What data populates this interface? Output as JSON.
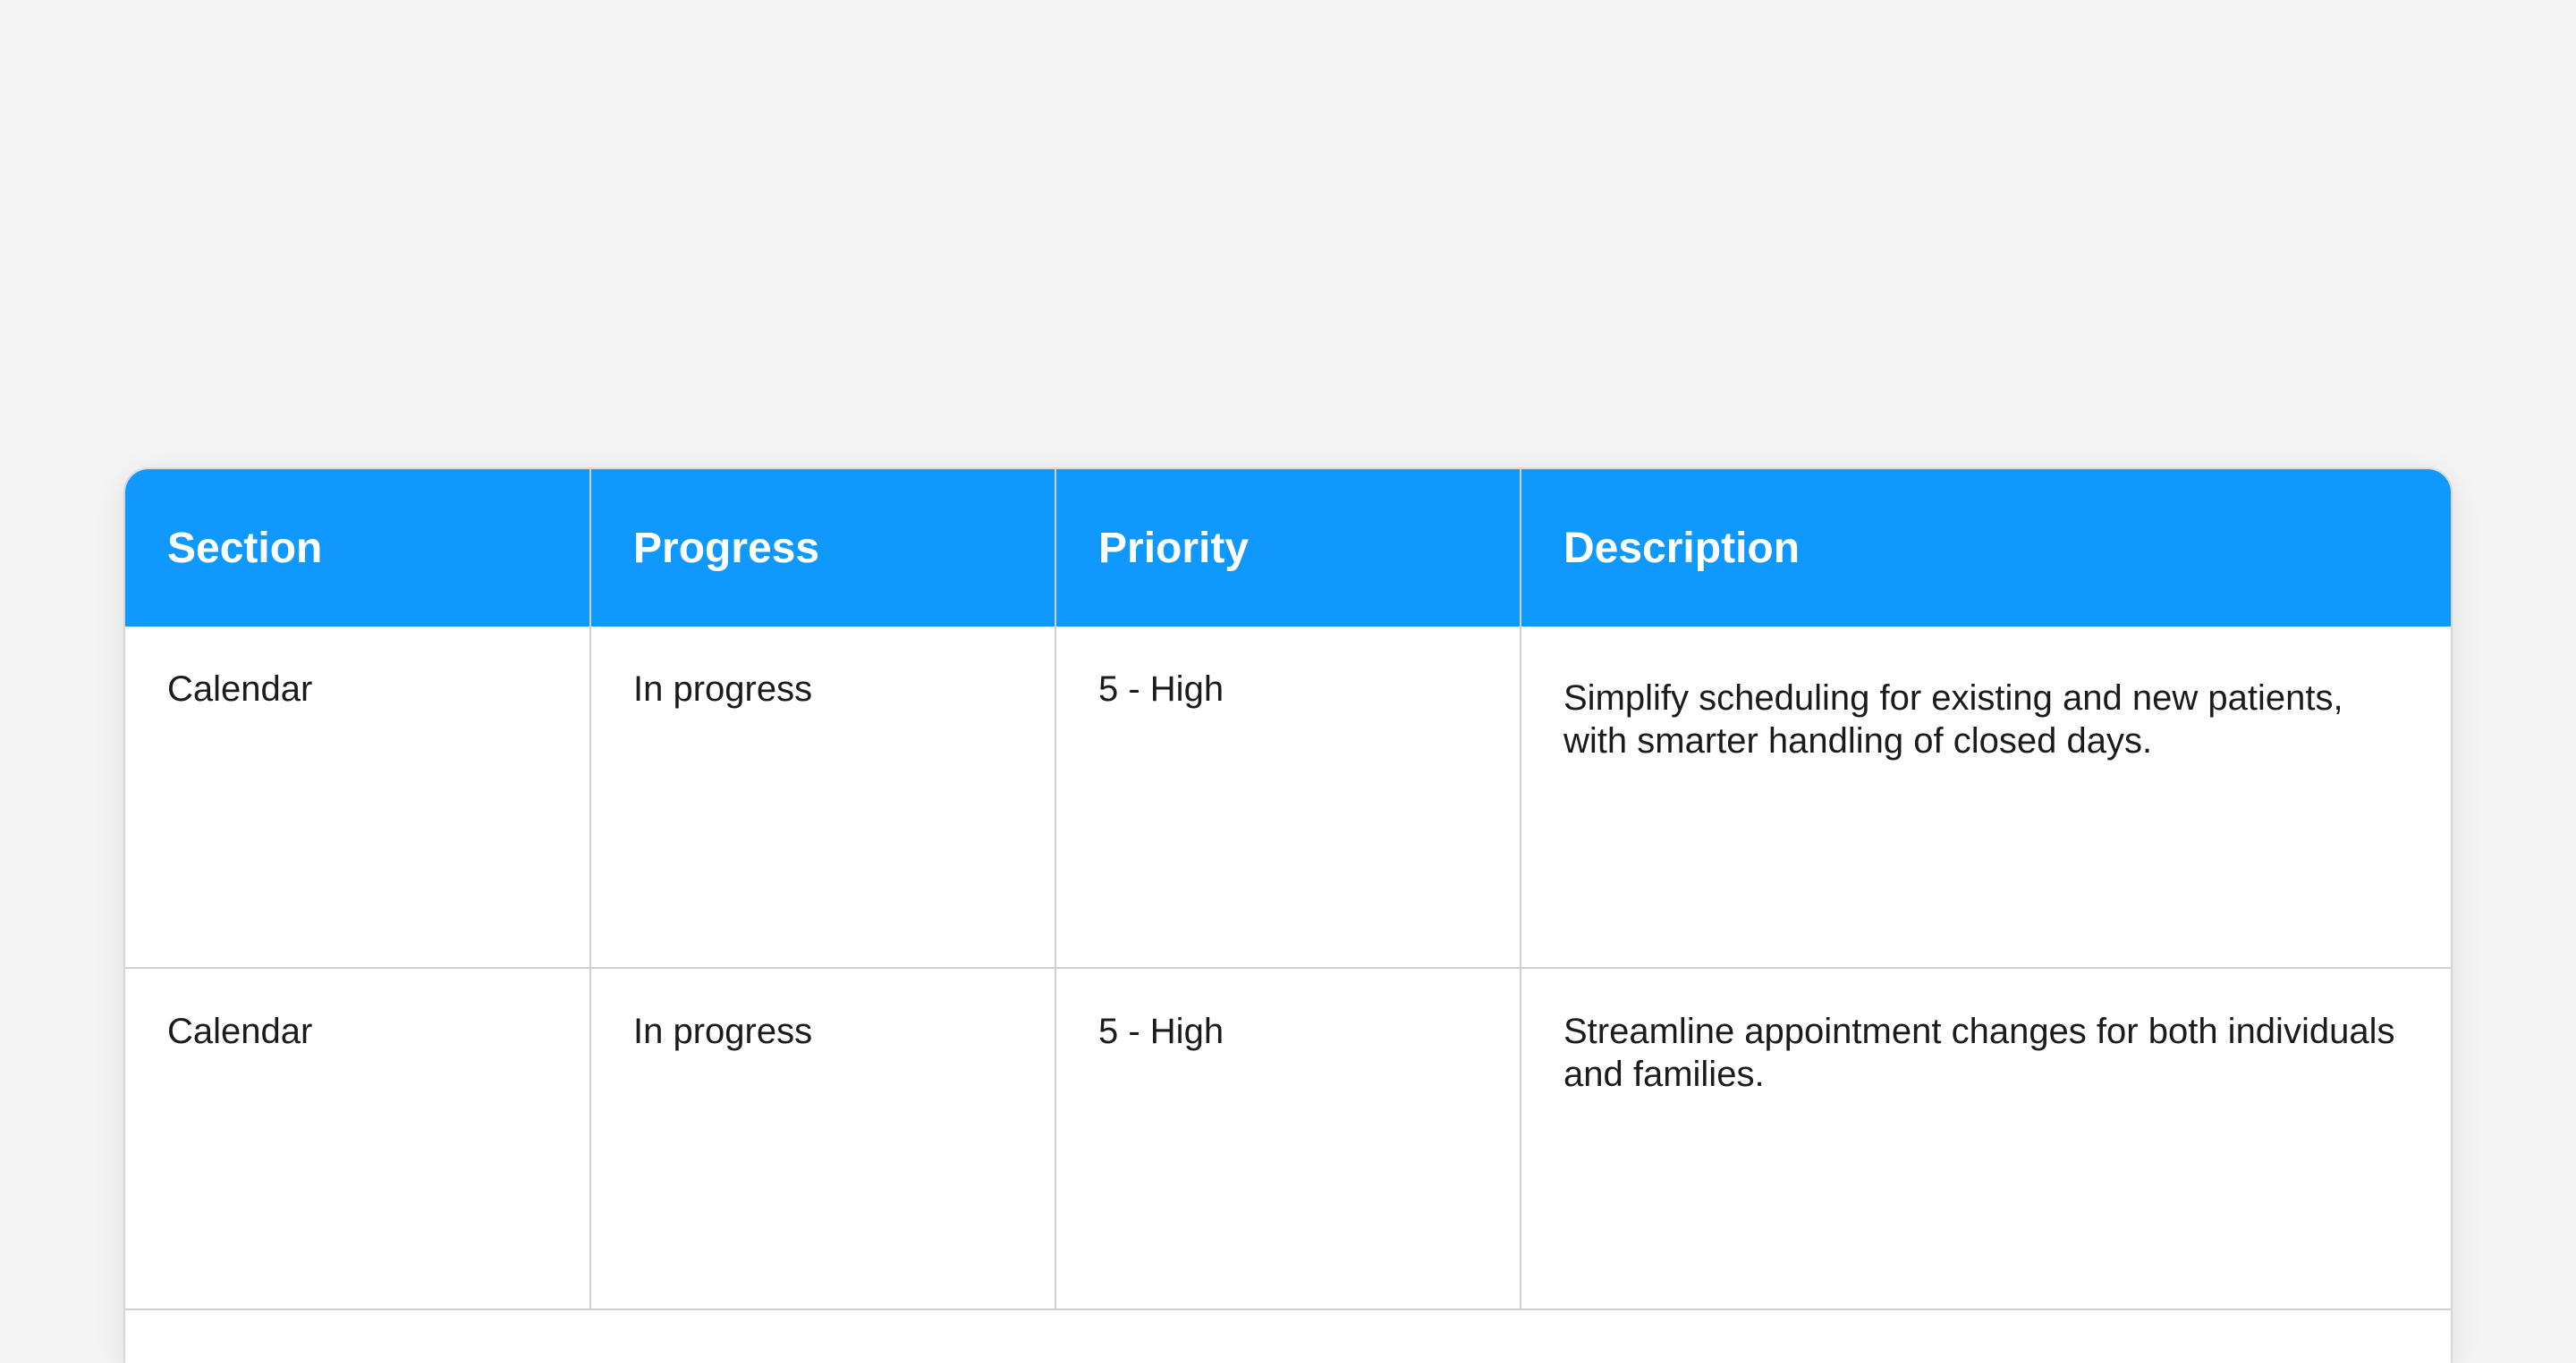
{
  "table": {
    "headers": [
      "Section",
      "Progress",
      "Priority",
      "Description"
    ],
    "rows": [
      {
        "section": "Calendar",
        "progress": "In progress",
        "priority": "5 - High",
        "description": "Simplify scheduling for existing and new patients, with smarter handling of closed days."
      },
      {
        "section": "Calendar",
        "progress": "In progress",
        "priority": "5 - High",
        "description": "Streamline appointment changes for both individuals and families."
      }
    ]
  },
  "colors": {
    "header_background": "#0f98fe",
    "header_text": "#ffffff",
    "page_background": "#f4f4f4",
    "cell_text": "#1b1b1b",
    "grid_lines": "#d0d0d0"
  }
}
